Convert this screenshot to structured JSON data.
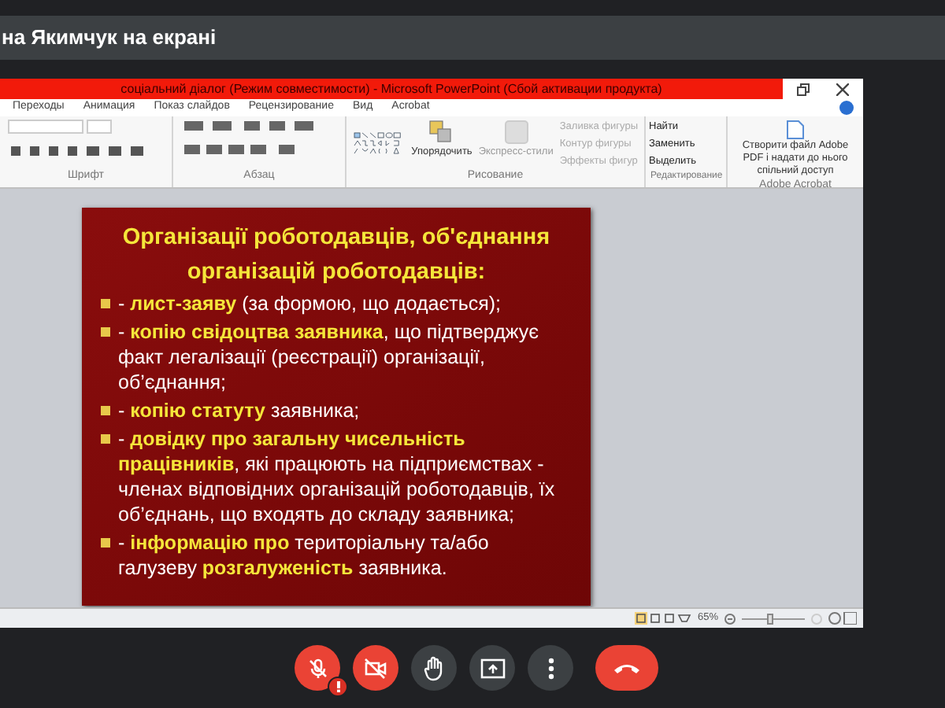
{
  "banner": {
    "text": "на Якимчук на екрані"
  },
  "window": {
    "title": "соціальний діалог (Режим совместимости)  -  Microsoft PowerPoint (Сбой активации продукта)"
  },
  "ribbon": {
    "tabs": [
      {
        "label": "Переходы"
      },
      {
        "label": "Анимация"
      },
      {
        "label": "Показ слайдов"
      },
      {
        "label": "Рецензирование"
      },
      {
        "label": "Вид"
      },
      {
        "label": "Acrobat"
      }
    ],
    "groups": [
      {
        "label": "Шрифт"
      },
      {
        "label": "Абзац"
      },
      {
        "label": "Рисование"
      },
      {
        "label": "Редактирование"
      },
      {
        "label": "Adobe Acrobat"
      }
    ],
    "drawing_buttons": [
      {
        "label": "Упорядочить"
      },
      {
        "label": "Экспресс-стили"
      }
    ],
    "shape_menu": [
      {
        "label": "Заливка фигуры",
        "disabled": true
      },
      {
        "label": "Контур фигуры",
        "disabled": true
      },
      {
        "label": "Эффекты фигур",
        "disabled": true
      }
    ],
    "editing_menu": [
      {
        "label": "Найти"
      },
      {
        "label": "Заменить"
      },
      {
        "label": "Выделить"
      }
    ],
    "acrobat_button": {
      "label": "Створити файл Adobe PDF і надати до нього спільний доступ"
    }
  },
  "slide": {
    "title": "Організації роботодавців, об'єднання організацій роботодавців:",
    "bullets": [
      "- **лист-заяву** (за формою, що додається);",
      "- **копію свідоцтва заявника**, що підтверджує факт легалізації (реєстрації) організації, об’єднання;",
      "- **копію статуту** заявника;",
      "- **довідку про загальну чисельність працівників**, які працюють на підприємствах - членах відповідних організацій роботодавців, їх об’єднань, що входять до складу заявника;",
      "- **інформацію про** територіальну та/або галузеву **розгалуженість** заявника."
    ]
  },
  "status_bar": {
    "zoom": "65%",
    "zoom_slider": {
      "level": 0.45
    }
  },
  "controls": [
    {
      "kind": "mic",
      "off": true,
      "warning": true
    },
    {
      "kind": "camera",
      "off": true,
      "warning": false
    },
    {
      "kind": "hand",
      "off": false,
      "warning": false
    },
    {
      "kind": "present",
      "off": false,
      "warning": false
    },
    {
      "kind": "more",
      "off": false,
      "warning": false
    },
    {
      "kind": "hangup"
    }
  ]
}
